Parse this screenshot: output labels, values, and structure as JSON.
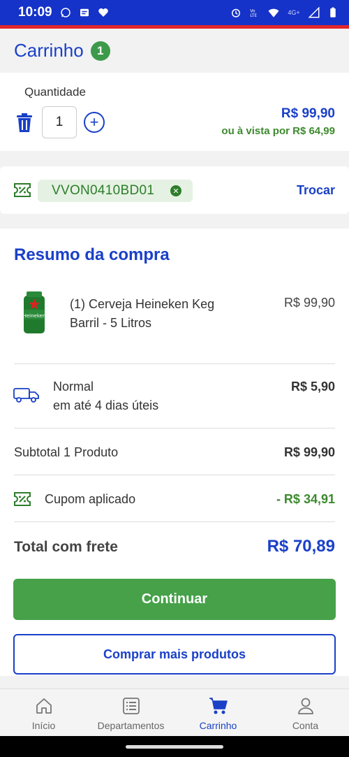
{
  "status_bar": {
    "time": "10:09",
    "network": "4G+"
  },
  "header": {
    "title": "Carrinho",
    "badge": "1"
  },
  "quantity": {
    "label": "Quantidade",
    "value": "1",
    "price": "R$ 99,90",
    "cash_price": "ou à vista por R$ 64,99"
  },
  "coupon": {
    "code": "VVON0410BD01",
    "swap_label": "Trocar"
  },
  "summary": {
    "title": "Resumo da compra",
    "product": {
      "name": "(1) Cerveja Heineken Keg Barril - 5 Litros",
      "price": "R$ 99,90",
      "image_brand": "Heineken"
    },
    "shipping": {
      "name": "Normal",
      "eta": "em até 4 dias úteis",
      "price": "R$ 5,90"
    },
    "subtotal": {
      "label": "Subtotal 1 Produto",
      "value": "R$ 99,90"
    },
    "coupon_applied": {
      "label": "Cupom aplicado",
      "value": "- R$ 34,91"
    },
    "total": {
      "label": "Total com frete",
      "value": "R$ 70,89"
    },
    "continue_label": "Continuar"
  },
  "more_products_label": "Comprar mais produtos",
  "bottom_nav": {
    "items": [
      {
        "label": "Início",
        "icon": "home-icon"
      },
      {
        "label": "Departamentos",
        "icon": "list-icon"
      },
      {
        "label": "Carrinho",
        "icon": "cart-icon"
      },
      {
        "label": "Conta",
        "icon": "user-icon"
      }
    ],
    "active": "Carrinho"
  },
  "colors": {
    "primary": "#1a40c8",
    "success": "#46a149",
    "status_bar": "#1532c9",
    "accent_line": "#e1262c"
  }
}
